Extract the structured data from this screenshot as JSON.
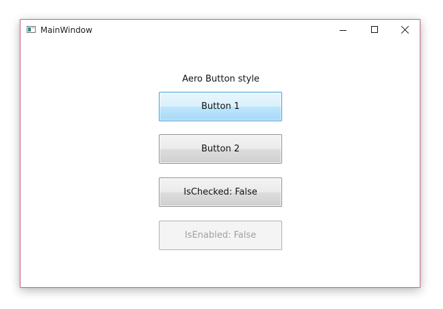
{
  "window": {
    "title": "MainWindow",
    "icon": "app-window-icon",
    "caption_buttons": {
      "minimize_icon": "minimize-icon",
      "maximize_icon": "maximize-icon",
      "close_icon": "close-icon"
    },
    "border_color": "#d0698f"
  },
  "content": {
    "label": "Aero Button style",
    "buttons": [
      {
        "label": "Button 1",
        "state": "hover"
      },
      {
        "label": "Button 2",
        "state": "normal"
      },
      {
        "label": "IsChecked: False",
        "state": "normal"
      },
      {
        "label": "IsEnabled: False",
        "state": "disabled"
      }
    ]
  },
  "colors": {
    "hover_border": "#3c9fd6",
    "disabled_text": "#a0a0a0"
  }
}
